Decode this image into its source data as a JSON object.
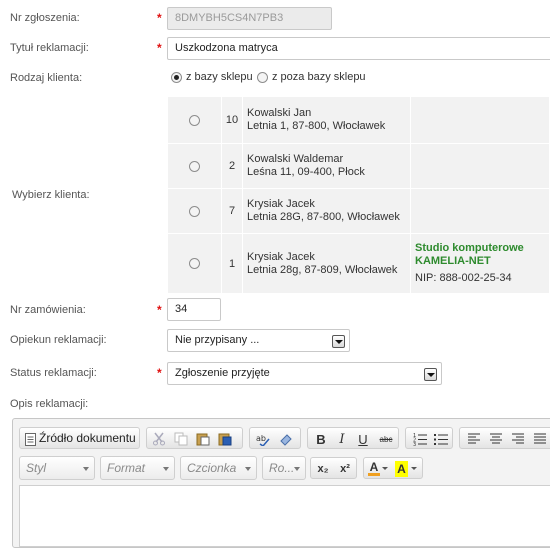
{
  "form": {
    "ticket_number": {
      "label": "Nr zgłoszenia:",
      "value": "8DMYBH5CS4N7PB3"
    },
    "title": {
      "label": "Tytuł reklamacji:",
      "value": "Uszkodzona matryca"
    },
    "client_type": {
      "label": "Rodzaj klienta:",
      "options": [
        "z bazy sklepu",
        "z poza bazy sklepu"
      ],
      "selected": "z bazy sklepu"
    },
    "choose_client": {
      "label": "Wybierz klienta:",
      "clients": [
        {
          "id": "10",
          "name": "Kowalski Jan",
          "address": "Letnia 1, 87-800, Włocławek",
          "company": "",
          "company2": "",
          "nip": ""
        },
        {
          "id": "2",
          "name": "Kowalski Waldemar",
          "address": "Leśna 11, 09-400, Płock",
          "company": "",
          "company2": "",
          "nip": ""
        },
        {
          "id": "7",
          "name": "Krysiak Jacek",
          "address": "Letnia 28G, 87-800, Włocławek",
          "company": "",
          "company2": "",
          "nip": ""
        },
        {
          "id": "1",
          "name": "Krysiak Jacek",
          "address": "Letnia 28g, 87-809, Włocławek",
          "company": "Studio komputerowe",
          "company2": "KAMELIA-NET",
          "nip": "NIP: 888-002-25-34"
        }
      ]
    },
    "order_number": {
      "label": "Nr zamówienia:",
      "value": "34"
    },
    "guardian": {
      "label": "Opiekun reklamacji:",
      "value": "Nie przypisany ..."
    },
    "status": {
      "label": "Status reklamacji:",
      "value": "Zgłoszenie przyjęte"
    },
    "description": {
      "label": "Opis reklamacji:"
    }
  },
  "editor": {
    "source_label": "Źródło dokumentu",
    "combos": [
      "Styl",
      "Format",
      "Czcionka",
      "Ro..."
    ],
    "bold": "B",
    "italic": "I",
    "underline": "U",
    "strike": "abc",
    "subscript": "x₂",
    "superscript": "x²",
    "text_color": "A",
    "bg_color": "A"
  },
  "colors": {
    "required": "#e01010",
    "company": "#2e8b2e",
    "highlight": "#ffff00"
  }
}
